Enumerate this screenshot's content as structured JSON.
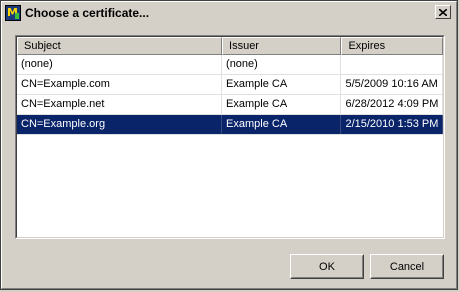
{
  "window": {
    "title": "Choose a certificate...",
    "icon": "app-icon",
    "close_icon": "close-icon"
  },
  "list": {
    "columns": [
      "Subject",
      "Issuer",
      "Expires"
    ],
    "rows": [
      {
        "subject": "(none)",
        "issuer": "(none)",
        "expires": "",
        "selected": false
      },
      {
        "subject": "CN=Example.com",
        "issuer": "Example CA",
        "expires": "5/5/2009 10:16 AM",
        "selected": false
      },
      {
        "subject": "CN=Example.net",
        "issuer": "Example CA",
        "expires": "6/28/2012 4:09 PM",
        "selected": false
      },
      {
        "subject": "CN=Example.org",
        "issuer": "Example CA",
        "expires": "2/15/2010 1:53 PM",
        "selected": true
      }
    ]
  },
  "buttons": {
    "ok": "OK",
    "cancel": "Cancel"
  },
  "colors": {
    "selection": "#0a246a",
    "face": "#d4d0c8"
  }
}
